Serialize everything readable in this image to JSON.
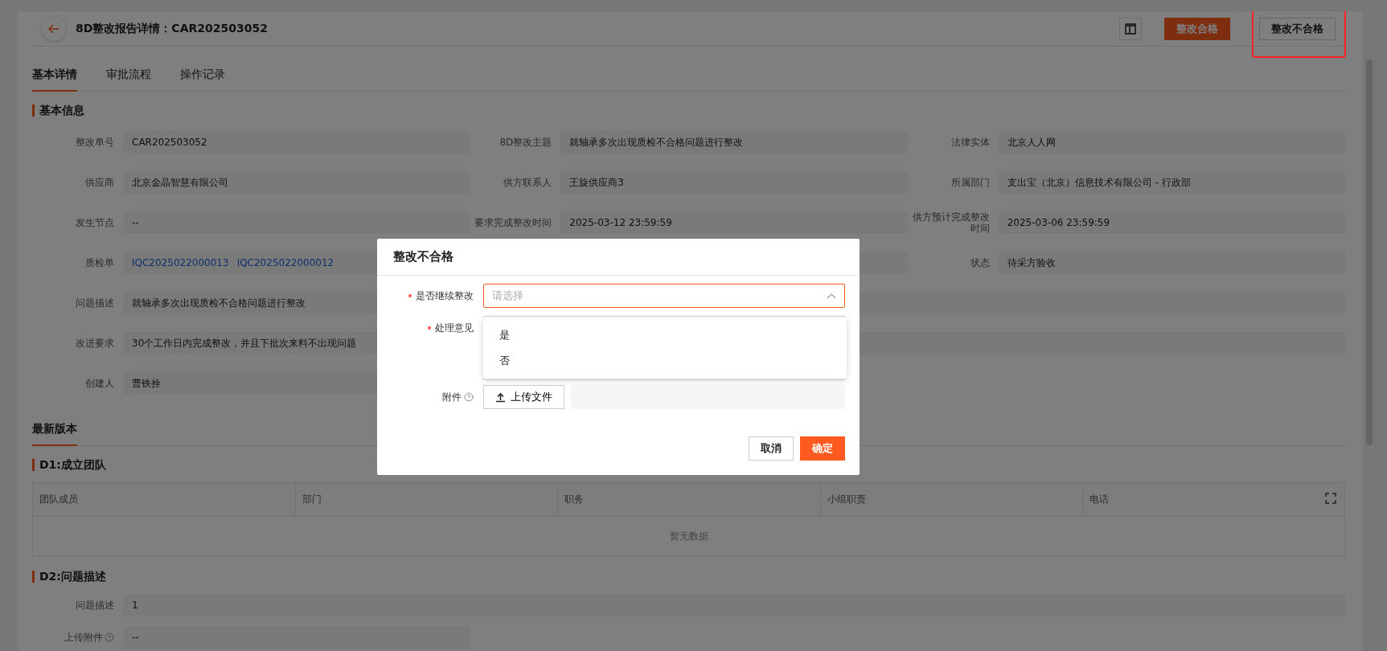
{
  "header": {
    "title": "8D整改报告详情：CAR202503052"
  },
  "actions": [
    {
      "label": "整改合格",
      "kind": "primary",
      "highlighted": false
    },
    {
      "label": "整改不合格",
      "kind": "default",
      "highlighted": true
    }
  ],
  "tabs": [
    {
      "label": "基本详情",
      "selected": true
    },
    {
      "label": "审批流程",
      "selected": false
    },
    {
      "label": "操作记录",
      "selected": false
    }
  ],
  "basic_info": {
    "title": "基本信息",
    "fields": [
      {
        "kind": "text",
        "label": "整改单号",
        "value": "CAR202503052"
      },
      {
        "kind": "text",
        "label": "8D整改主题",
        "value": "就轴承多次出现质检不合格问题进行整改"
      },
      {
        "kind": "text",
        "label": "法律实体",
        "value": "北京人人网"
      },
      {
        "kind": "text",
        "label": "供应商",
        "value": "北京金晶智慧有限公司"
      },
      {
        "kind": "text",
        "label": "供方联系人",
        "value": "王旋供应商3"
      },
      {
        "kind": "text",
        "label": "所属部门",
        "value": "支出宝（北京）信息技术有限公司 - 行政部"
      },
      {
        "kind": "text",
        "label": "发生节点",
        "value": "--"
      },
      {
        "kind": "text",
        "label": "要求完成整改时间",
        "value": "2025-03-12 23:59:59"
      },
      {
        "kind": "text",
        "label": "供方预计完成整改时间",
        "value": "2025-03-06 23:59:59"
      },
      {
        "kind": "links",
        "label": "质检单",
        "links": [
          "IQC2025022000013",
          "IQC2025022000012"
        ]
      },
      {
        "kind": "covered"
      },
      {
        "kind": "text",
        "label": "状态",
        "value": "待采方验收"
      },
      {
        "kind": "wide",
        "label": "问题描述",
        "value": "就轴承多次出现质检不合格问题进行整改"
      },
      {
        "kind": "wide",
        "label": "改进要求",
        "value": "30个工作日内完成整改，并且下批次来料不出现问题"
      },
      {
        "kind": "text",
        "label": "创建人",
        "value": "曹铁拴"
      }
    ]
  },
  "version_tabs": [
    {
      "label": "最新版本",
      "selected": true
    }
  ],
  "d1": {
    "title": "D1:成立团队",
    "columns": [
      "团队成员",
      "部门",
      "职务",
      "小组职责",
      "电话"
    ],
    "empty_text": "暂无数据"
  },
  "d2": {
    "title": "D2:问题描述",
    "fields": [
      {
        "kind": "wide",
        "label": "问题描述",
        "value": "1"
      },
      {
        "kind": "text",
        "label": "上传附件",
        "value": "--",
        "help": true
      }
    ]
  },
  "modal": {
    "title": "整改不合格",
    "fields": [
      {
        "kind": "select",
        "label": "是否继续整改",
        "required": true,
        "placeholder": "请选择",
        "expanded": true,
        "options": [
          {
            "label": "是",
            "selected": false
          },
          {
            "label": "否",
            "selected": false
          }
        ]
      },
      {
        "kind": "textarea",
        "label": "处理意见",
        "required": true
      },
      {
        "kind": "upload",
        "label": "附件",
        "required": false,
        "help": true,
        "button": "上传文件"
      }
    ],
    "buttons": [
      {
        "label": "取消",
        "kind": "default"
      },
      {
        "label": "确定",
        "kind": "primary"
      }
    ]
  }
}
